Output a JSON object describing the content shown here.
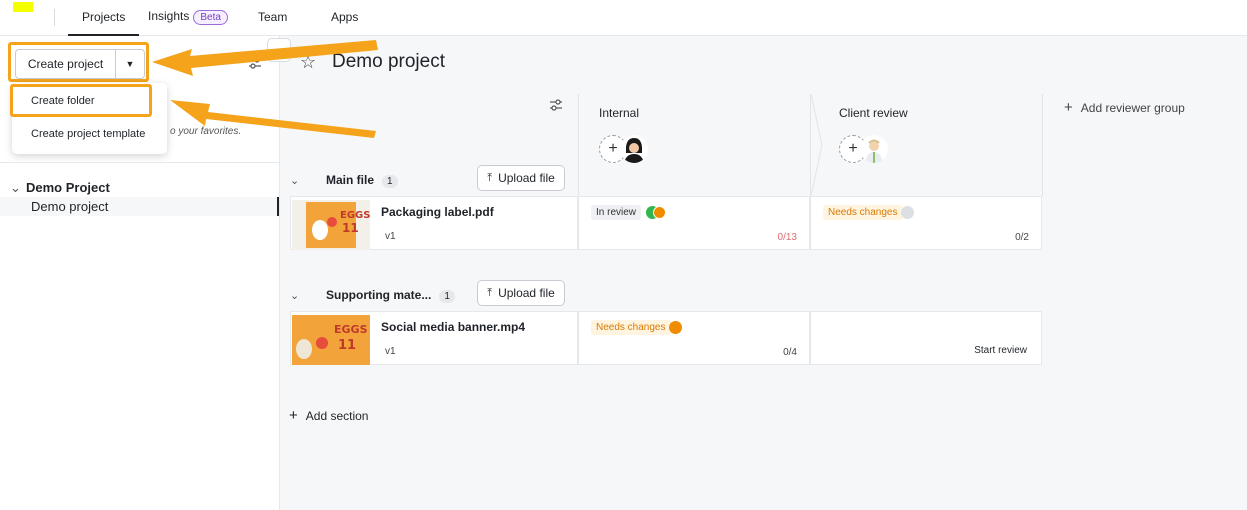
{
  "nav": {
    "tabs": [
      {
        "label": "Projects",
        "active": true
      },
      {
        "label": "Insights",
        "badge": "Beta"
      },
      {
        "label": "Team"
      },
      {
        "label": "Apps"
      }
    ]
  },
  "sidebar": {
    "create_project_label": "Create project",
    "menu": {
      "items": [
        "Create folder",
        "Create project template"
      ]
    },
    "favorites_hint": "o your favorites.",
    "tree": {
      "group_label": "Demo Project",
      "item_label": "Demo project"
    }
  },
  "main": {
    "project_title": "Demo project",
    "columns": [
      {
        "title": "Internal"
      },
      {
        "title": "Client review"
      }
    ],
    "add_reviewer_group_label": "Add reviewer group",
    "sections": [
      {
        "name": "Main file",
        "count": "1",
        "upload_label": "Upload file",
        "file": {
          "name": "Packaging label.pdf",
          "version": "v1",
          "internal": {
            "status": "In review",
            "count": "0/13"
          },
          "client": {
            "status": "Needs changes",
            "count": "0/2"
          }
        }
      },
      {
        "name": "Supporting mate...",
        "count": "1",
        "upload_label": "Upload file",
        "file": {
          "name": "Social media banner.mp4",
          "version": "v1",
          "internal": {
            "status": "Needs changes",
            "count": "0/4"
          },
          "client": {
            "action": "Start review"
          }
        }
      }
    ],
    "add_section_label": "Add section"
  },
  "colors": {
    "highlight": "#f4a31b",
    "status_green": "#2fb84f",
    "status_orange": "#f08c00",
    "status_grey": "#dcdfe3"
  }
}
